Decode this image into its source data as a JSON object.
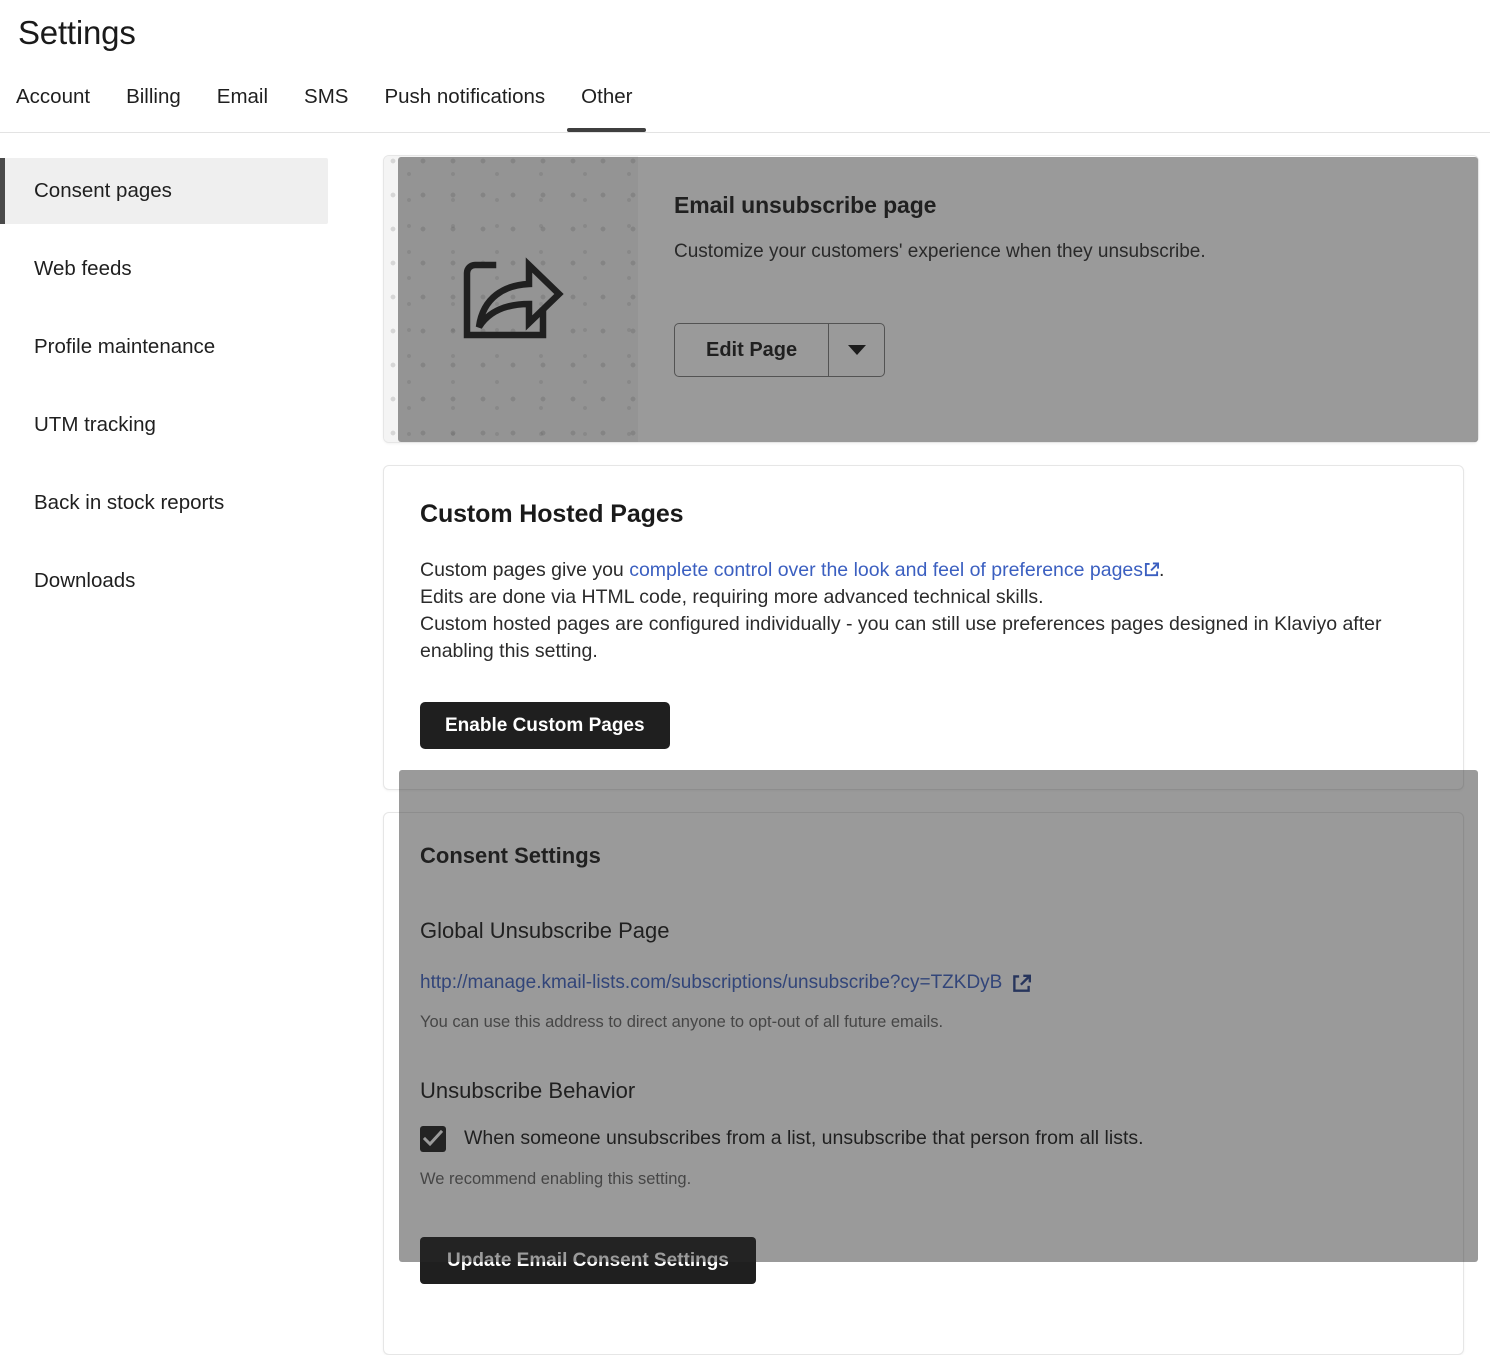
{
  "header": {
    "title": "Settings",
    "tabs": [
      {
        "label": "Account",
        "active": false
      },
      {
        "label": "Billing",
        "active": false
      },
      {
        "label": "Email",
        "active": false
      },
      {
        "label": "SMS",
        "active": false
      },
      {
        "label": "Push notifications",
        "active": false
      },
      {
        "label": "Other",
        "active": true
      }
    ]
  },
  "sidebar": {
    "items": [
      {
        "label": "Consent pages",
        "active": true
      },
      {
        "label": "Web feeds",
        "active": false
      },
      {
        "label": "Profile maintenance",
        "active": false
      },
      {
        "label": "UTM tracking",
        "active": false
      },
      {
        "label": "Back in stock reports",
        "active": false
      },
      {
        "label": "Downloads",
        "active": false
      }
    ]
  },
  "unsubscribe_card": {
    "illustration_icon": "share-arrow-icon",
    "title": "Email unsubscribe page",
    "description": "Customize your customers' experience when they unsubscribe.",
    "edit_button_label": "Edit Page",
    "dropdown_icon": "chevron-down-icon"
  },
  "custom_hosted_pages": {
    "title": "Custom Hosted Pages",
    "line1_before_link": "Custom pages give you ",
    "line1_link": "complete control over the look and feel of preference pages",
    "line1_after_link": ".",
    "line2": "Edits are done via HTML code, requiring more advanced technical skills.",
    "line3": "Custom hosted pages are configured individually - you can still use preferences pages designed in Klaviyo after enabling this setting.",
    "enable_button_label": "Enable Custom Pages",
    "link_color": "#3b5fc0"
  },
  "consent_settings": {
    "title": "Consent Settings",
    "global_unsubscribe_heading": "Global Unsubscribe Page",
    "global_unsubscribe_url": "http://manage.kmail-lists.com/subscriptions/unsubscribe?cy=TZKDyB",
    "global_unsubscribe_helper": "You can use this address to direct anyone to opt-out of all future emails.",
    "unsubscribe_behavior_heading": "Unsubscribe Behavior",
    "checkbox_label": "When someone unsubscribes from a list, unsubscribe that person from all lists.",
    "checkbox_checked": true,
    "checkbox_helper": "We recommend enabling this setting.",
    "update_button_label": "Update Email Consent Settings",
    "external_link_icon": "external-link-icon"
  },
  "colors": {
    "accent_dark": "#1f1f1f",
    "link_blue": "#3b5fc0",
    "active_sidebar_bg": "#efefef",
    "dim_overlay": "rgba(40,40,40,0.47)"
  }
}
